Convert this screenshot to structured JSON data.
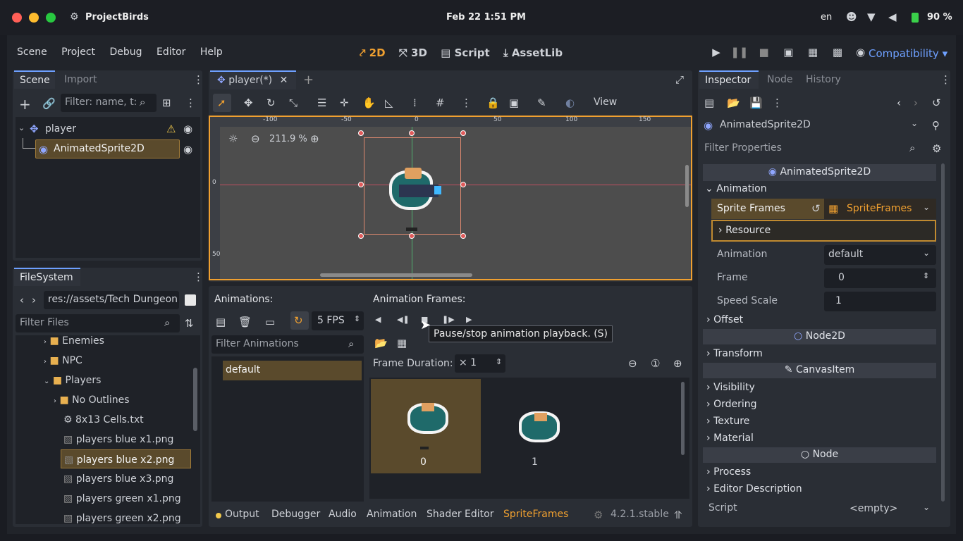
{
  "os": {
    "app": "ProjectBirds",
    "datetime": "Feb 22  1:51 PM",
    "lang": "en",
    "battery": "90 %"
  },
  "menu": {
    "items": [
      "Scene",
      "Project",
      "Debug",
      "Editor",
      "Help"
    ]
  },
  "modes": {
    "m2d": "2D",
    "m3d": "3D",
    "script": "Script",
    "assetlib": "AssetLib"
  },
  "renderer": "Compatibility",
  "scene_dock": {
    "tabs": [
      "Scene",
      "Import"
    ],
    "filter_placeholder": "Filter: name, t:",
    "tree": [
      {
        "label": "player"
      },
      {
        "label": "AnimatedSprite2D"
      }
    ]
  },
  "fs_dock": {
    "tab": "FileSystem",
    "path": "res://assets/Tech Dungeon",
    "filter_placeholder": "Filter Files",
    "items": [
      "Enemies",
      "NPC",
      "Players",
      "No Outlines",
      "8x13 Cells.txt",
      "players blue x1.png",
      "players blue x2.png",
      "players blue x3.png",
      "players green x1.png",
      "players green x2.png"
    ]
  },
  "viewport": {
    "tab": "player(*)",
    "zoom": "211.9 %",
    "view_label": "View",
    "ruler": [
      "-100",
      "-50",
      "0",
      "50",
      "100",
      "150"
    ],
    "vruler": [
      "0",
      "50"
    ]
  },
  "anim_panel": {
    "animations_label": "Animations:",
    "frames_label": "Animation Frames:",
    "fps": "5 FPS",
    "filter_placeholder": "Filter Animations",
    "animations": [
      "default"
    ],
    "frame_duration_label": "Frame Duration:",
    "frame_duration": "× 1",
    "frames": [
      "0",
      "1"
    ],
    "tooltip": "Pause/stop animation playback. (S)"
  },
  "bottom": {
    "tabs": [
      "Output",
      "Debugger",
      "Audio",
      "Animation",
      "Shader Editor",
      "SpriteFrames"
    ],
    "version": "4.2.1.stable"
  },
  "inspector": {
    "tabs": [
      "Inspector",
      "Node",
      "History"
    ],
    "node_type": "AnimatedSprite2D",
    "filter_placeholder": "Filter Properties",
    "class_header": "AnimatedSprite2D",
    "animation_section": "Animation",
    "sprite_frames_label": "Sprite Frames",
    "sprite_frames_value": "SpriteFrames",
    "resource": "Resource",
    "props": [
      {
        "k": "Animation",
        "v": "default"
      },
      {
        "k": "Frame",
        "v": "0"
      },
      {
        "k": "Speed Scale",
        "v": "1"
      }
    ],
    "offset": "Offset",
    "node2d": "Node2D",
    "transform": "Transform",
    "canvasitem": "CanvasItem",
    "ci_sections": [
      "Visibility",
      "Ordering",
      "Texture",
      "Material"
    ],
    "node": "Node",
    "node_sections": [
      "Process",
      "Editor Description"
    ],
    "script_label": "Script",
    "script_value": "<empty>"
  },
  "colors": {
    "accent": "#f0a030",
    "blue": "#6ea0ff",
    "select": "#5a4a2c"
  }
}
